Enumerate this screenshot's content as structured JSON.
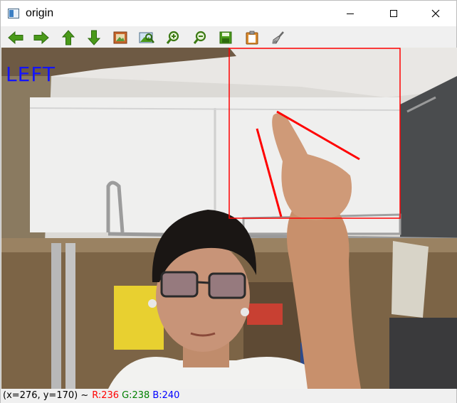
{
  "window": {
    "title": "origin"
  },
  "toolbar": {
    "buttons": [
      {
        "icon": "arrow-left-icon",
        "label": "Pan left"
      },
      {
        "icon": "arrow-right-icon",
        "label": "Pan right"
      },
      {
        "icon": "arrow-up-icon",
        "label": "Pan up"
      },
      {
        "icon": "arrow-down-icon",
        "label": "Pan down"
      },
      {
        "icon": "image-icon",
        "label": "Zoom x1"
      },
      {
        "icon": "zoom-image-icon",
        "label": "Zoom to fit"
      },
      {
        "icon": "zoom-in-icon",
        "label": "Zoom in"
      },
      {
        "icon": "zoom-out-icon",
        "label": "Zoom out"
      },
      {
        "icon": "save-icon",
        "label": "Save"
      },
      {
        "icon": "clipboard-icon",
        "label": "Copy to clipboard"
      },
      {
        "icon": "brush-icon",
        "label": "Properties"
      }
    ]
  },
  "image": {
    "overlay_text": "LEFT",
    "overlay_color": "#1414ff",
    "roi_color": "#ff0000"
  },
  "status": {
    "coords": "(x=276, y=170) ~",
    "r": "R:236",
    "g": "G:238",
    "b": "B:240"
  },
  "colors": {
    "toolbar_icon_green": "#4a9a1a",
    "status_r": "#ff0000",
    "status_g": "#008000",
    "status_b": "#0000ff"
  }
}
